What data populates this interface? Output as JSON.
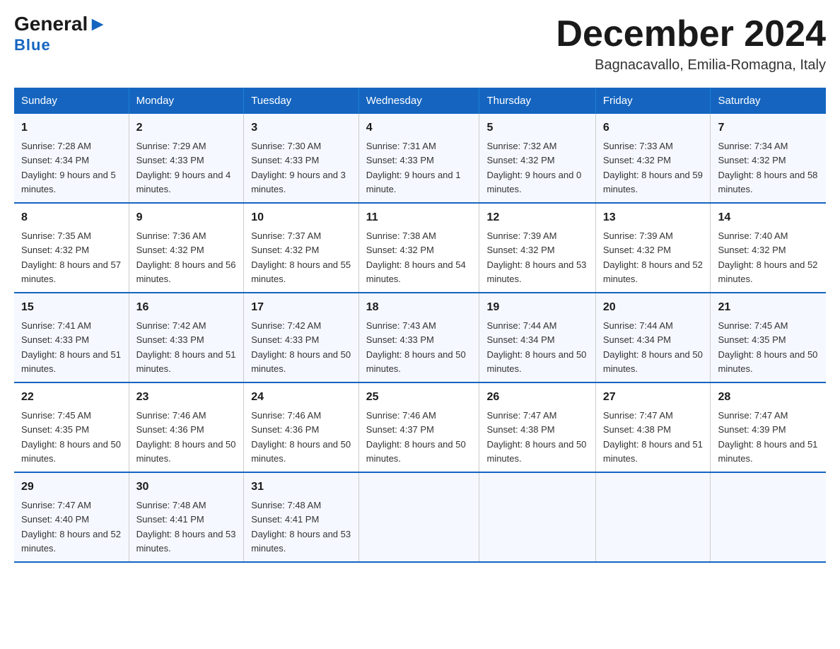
{
  "header": {
    "logo_general": "General",
    "logo_blue": "Blue",
    "main_title": "December 2024",
    "subtitle": "Bagnacavallo, Emilia-Romagna, Italy"
  },
  "days_of_week": [
    "Sunday",
    "Monday",
    "Tuesday",
    "Wednesday",
    "Thursday",
    "Friday",
    "Saturday"
  ],
  "weeks": [
    [
      {
        "day": 1,
        "sunrise": "7:28 AM",
        "sunset": "4:34 PM",
        "daylight": "9 hours and 5 minutes."
      },
      {
        "day": 2,
        "sunrise": "7:29 AM",
        "sunset": "4:33 PM",
        "daylight": "9 hours and 4 minutes."
      },
      {
        "day": 3,
        "sunrise": "7:30 AM",
        "sunset": "4:33 PM",
        "daylight": "9 hours and 3 minutes."
      },
      {
        "day": 4,
        "sunrise": "7:31 AM",
        "sunset": "4:33 PM",
        "daylight": "9 hours and 1 minute."
      },
      {
        "day": 5,
        "sunrise": "7:32 AM",
        "sunset": "4:32 PM",
        "daylight": "9 hours and 0 minutes."
      },
      {
        "day": 6,
        "sunrise": "7:33 AM",
        "sunset": "4:32 PM",
        "daylight": "8 hours and 59 minutes."
      },
      {
        "day": 7,
        "sunrise": "7:34 AM",
        "sunset": "4:32 PM",
        "daylight": "8 hours and 58 minutes."
      }
    ],
    [
      {
        "day": 8,
        "sunrise": "7:35 AM",
        "sunset": "4:32 PM",
        "daylight": "8 hours and 57 minutes."
      },
      {
        "day": 9,
        "sunrise": "7:36 AM",
        "sunset": "4:32 PM",
        "daylight": "8 hours and 56 minutes."
      },
      {
        "day": 10,
        "sunrise": "7:37 AM",
        "sunset": "4:32 PM",
        "daylight": "8 hours and 55 minutes."
      },
      {
        "day": 11,
        "sunrise": "7:38 AM",
        "sunset": "4:32 PM",
        "daylight": "8 hours and 54 minutes."
      },
      {
        "day": 12,
        "sunrise": "7:39 AM",
        "sunset": "4:32 PM",
        "daylight": "8 hours and 53 minutes."
      },
      {
        "day": 13,
        "sunrise": "7:39 AM",
        "sunset": "4:32 PM",
        "daylight": "8 hours and 52 minutes."
      },
      {
        "day": 14,
        "sunrise": "7:40 AM",
        "sunset": "4:32 PM",
        "daylight": "8 hours and 52 minutes."
      }
    ],
    [
      {
        "day": 15,
        "sunrise": "7:41 AM",
        "sunset": "4:33 PM",
        "daylight": "8 hours and 51 minutes."
      },
      {
        "day": 16,
        "sunrise": "7:42 AM",
        "sunset": "4:33 PM",
        "daylight": "8 hours and 51 minutes."
      },
      {
        "day": 17,
        "sunrise": "7:42 AM",
        "sunset": "4:33 PM",
        "daylight": "8 hours and 50 minutes."
      },
      {
        "day": 18,
        "sunrise": "7:43 AM",
        "sunset": "4:33 PM",
        "daylight": "8 hours and 50 minutes."
      },
      {
        "day": 19,
        "sunrise": "7:44 AM",
        "sunset": "4:34 PM",
        "daylight": "8 hours and 50 minutes."
      },
      {
        "day": 20,
        "sunrise": "7:44 AM",
        "sunset": "4:34 PM",
        "daylight": "8 hours and 50 minutes."
      },
      {
        "day": 21,
        "sunrise": "7:45 AM",
        "sunset": "4:35 PM",
        "daylight": "8 hours and 50 minutes."
      }
    ],
    [
      {
        "day": 22,
        "sunrise": "7:45 AM",
        "sunset": "4:35 PM",
        "daylight": "8 hours and 50 minutes."
      },
      {
        "day": 23,
        "sunrise": "7:46 AM",
        "sunset": "4:36 PM",
        "daylight": "8 hours and 50 minutes."
      },
      {
        "day": 24,
        "sunrise": "7:46 AM",
        "sunset": "4:36 PM",
        "daylight": "8 hours and 50 minutes."
      },
      {
        "day": 25,
        "sunrise": "7:46 AM",
        "sunset": "4:37 PM",
        "daylight": "8 hours and 50 minutes."
      },
      {
        "day": 26,
        "sunrise": "7:47 AM",
        "sunset": "4:38 PM",
        "daylight": "8 hours and 50 minutes."
      },
      {
        "day": 27,
        "sunrise": "7:47 AM",
        "sunset": "4:38 PM",
        "daylight": "8 hours and 51 minutes."
      },
      {
        "day": 28,
        "sunrise": "7:47 AM",
        "sunset": "4:39 PM",
        "daylight": "8 hours and 51 minutes."
      }
    ],
    [
      {
        "day": 29,
        "sunrise": "7:47 AM",
        "sunset": "4:40 PM",
        "daylight": "8 hours and 52 minutes."
      },
      {
        "day": 30,
        "sunrise": "7:48 AM",
        "sunset": "4:41 PM",
        "daylight": "8 hours and 53 minutes."
      },
      {
        "day": 31,
        "sunrise": "7:48 AM",
        "sunset": "4:41 PM",
        "daylight": "8 hours and 53 minutes."
      },
      null,
      null,
      null,
      null
    ]
  ],
  "labels": {
    "sunrise": "Sunrise:",
    "sunset": "Sunset:",
    "daylight": "Daylight:"
  }
}
